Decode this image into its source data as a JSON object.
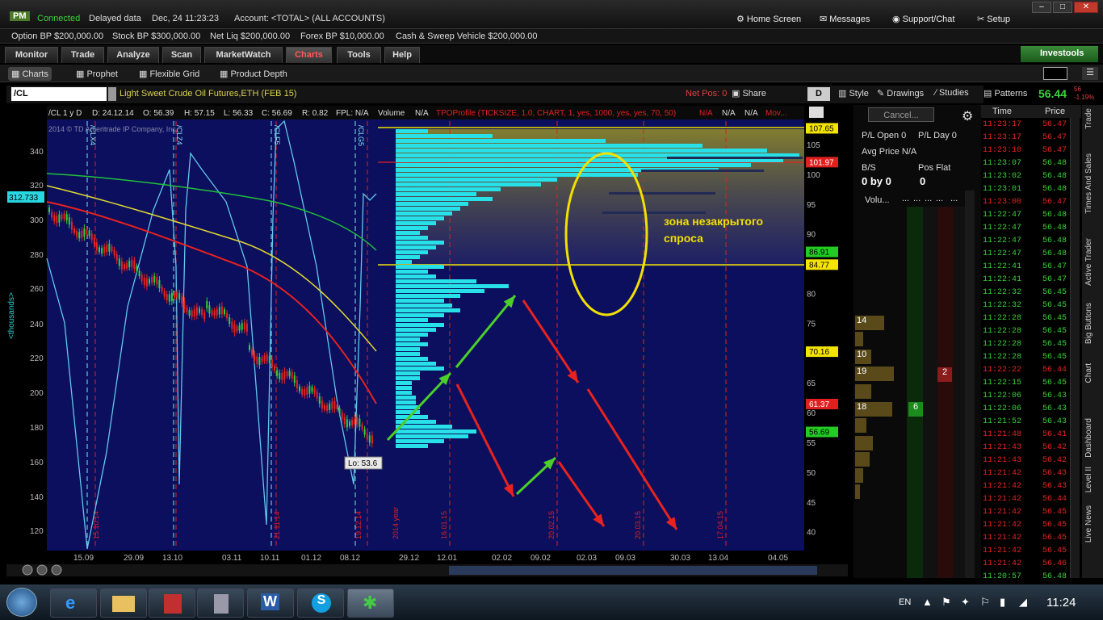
{
  "top": {
    "badge": "PM",
    "connected": "Connected",
    "delayed": "Delayed data",
    "datetime": "Dec, 24  11:23:23",
    "account": "Account: <TOTAL> (ALL ACCOUNTS)",
    "home": "Home Screen",
    "messages": "Messages",
    "support": "Support/Chat",
    "setup": "Setup"
  },
  "acct": [
    {
      "label": "Option BP",
      "value": "$200,000.00"
    },
    {
      "label": "Stock BP",
      "value": "$300,000.00"
    },
    {
      "label": "Net Liq",
      "value": "$200,000.00"
    },
    {
      "label": "Forex BP",
      "value": "$10,000.00"
    },
    {
      "label": "Cash & Sweep Vehicle",
      "value": "$200,000.00"
    }
  ],
  "tabs": [
    "Monitor",
    "Trade",
    "Analyze",
    "Scan",
    "MarketWatch",
    "Charts",
    "Tools",
    "Help"
  ],
  "investools": "Investools",
  "subtabs": [
    "Charts",
    "Prophet",
    "Flexible Grid",
    "Product Depth"
  ],
  "symbol": {
    "value": "/CL",
    "desc": "Light Sweet Crude Oil Futures,ETH (FEB 15)",
    "netpos": "Net Pos: 0",
    "share": "Share",
    "d": "D",
    "style": "Style",
    "drawings": "Drawings",
    "studies": "Studies",
    "patterns": "Patterns",
    "last": "56.44",
    "change1": "56",
    "change2": "-1.19%"
  },
  "chartinfo": {
    "sym": "/CL 1 y D",
    "d": "D: 24.12.14",
    "o": "O: 56.39",
    "h": "H: 57.15",
    "l": "L: 56.33",
    "c": "C: 56.69",
    "r": "R: 0.82",
    "fpl": "FPL: N/A",
    "vol": "Volume",
    "na1": "N/A",
    "tpo": "TPOProfile (TICKSIZE, 1.0, CHART, 1, yes, 1000, yes, yes, 70, 50)",
    "na2": "N/A",
    "na3": "N/A",
    "na4": "N/A",
    "mov": "Mov...",
    "copyright": "2014 © TD Ameritrade IP Company, Inc."
  },
  "annotation": "зона незакрытого спроса",
  "lowlabel": "Lo: 53.6",
  "leftY": [
    "340",
    "320",
    "300",
    "280",
    "260",
    "240",
    "220",
    "200",
    "180",
    "160",
    "140",
    "120"
  ],
  "leftYTitle": "<thousands>",
  "leftBadge": "312.733",
  "rightY": [
    "105",
    "100",
    "95",
    "90",
    "85",
    "80",
    "75",
    "70",
    "65",
    "60",
    "55",
    "50",
    "45",
    "40"
  ],
  "priceBadges": [
    {
      "v": "107.65",
      "c": "#f5e400"
    },
    {
      "v": "101.97",
      "c": "#e02020"
    },
    {
      "v": "86.91",
      "c": "#22cc22"
    },
    {
      "v": "84.77",
      "c": "#f5e400"
    },
    {
      "v": "70.16",
      "c": "#f5e400"
    },
    {
      "v": "61.37",
      "c": "#e02020"
    },
    {
      "v": "56.69",
      "c": "#22cc22"
    }
  ],
  "xlabels": [
    "15.09",
    "29.09",
    "13.10",
    "03.11",
    "10.11",
    "01.12",
    "08.12",
    "29.12",
    "12.01",
    "02.02",
    "09.02",
    "02.03",
    "09.03",
    "30.03",
    "13.04",
    "04.05"
  ],
  "contractLabels": [
    "/CLX4",
    "/CLZ4",
    "/CLF5",
    "/CLG5"
  ],
  "expiryLabels": [
    "15.10.14",
    "21.11.14",
    "19.12.14",
    "2014 year",
    "16.01.15",
    "20.02.15",
    "20.03.15",
    "17.04.15"
  ],
  "order": {
    "cancel": "Cancel...",
    "plopen": "P/L Open",
    "plopenv": "0",
    "plday": "P/L Day",
    "pldayv": "0",
    "avg": "Avg Price N/A",
    "bs": "B/S",
    "bsv": "0 by 0",
    "posflat": "Pos Flat",
    "posflatv": "0",
    "vol": "Volu...",
    "dots": "...",
    "ladder": [
      "14",
      "10",
      "19",
      "18"
    ],
    "ladderA": "6",
    "ladderB": "2"
  },
  "ts": {
    "head_time": "Time",
    "head_price": "Price",
    "rows": [
      [
        "11:23:17",
        "56.47",
        "r"
      ],
      [
        "11:23:17",
        "56.47",
        "r"
      ],
      [
        "11:23:10",
        "56.47",
        "r"
      ],
      [
        "11:23:07",
        "56.48",
        "g"
      ],
      [
        "11:23:02",
        "56.48",
        "g"
      ],
      [
        "11:23:01",
        "56.48",
        "g"
      ],
      [
        "11:23:00",
        "56.47",
        "r"
      ],
      [
        "11:22:47",
        "56.48",
        "g"
      ],
      [
        "11:22:47",
        "56.48",
        "g"
      ],
      [
        "11:22:47",
        "56.48",
        "g"
      ],
      [
        "11:22:47",
        "56.48",
        "g"
      ],
      [
        "11:22:41",
        "56.47",
        "g"
      ],
      [
        "11:22:41",
        "56.47",
        "g"
      ],
      [
        "11:22:32",
        "56.45",
        "g"
      ],
      [
        "11:22:32",
        "56.45",
        "g"
      ],
      [
        "11:22:28",
        "56.45",
        "g"
      ],
      [
        "11:22:28",
        "56.45",
        "g"
      ],
      [
        "11:22:28",
        "56.45",
        "g"
      ],
      [
        "11:22:28",
        "56.45",
        "g"
      ],
      [
        "11:22:22",
        "56.44",
        "r"
      ],
      [
        "11:22:15",
        "56.45",
        "g"
      ],
      [
        "11:22:06",
        "56.43",
        "g"
      ],
      [
        "11:22:06",
        "56.43",
        "g"
      ],
      [
        "11:21:52",
        "56.43",
        "g"
      ],
      [
        "11:21:48",
        "56.41",
        "r"
      ],
      [
        "11:21:43",
        "56.42",
        "r"
      ],
      [
        "11:21:43",
        "56.42",
        "r"
      ],
      [
        "11:21:42",
        "56.43",
        "r"
      ],
      [
        "11:21:42",
        "56.43",
        "r"
      ],
      [
        "11:21:42",
        "56.44",
        "r"
      ],
      [
        "11:21:42",
        "56.45",
        "r"
      ],
      [
        "11:21:42",
        "56.45",
        "r"
      ],
      [
        "11:21:42",
        "56.45",
        "r"
      ],
      [
        "11:21:42",
        "56.45",
        "r"
      ],
      [
        "11:21:42",
        "56.46",
        "r"
      ],
      [
        "11:20:57",
        "56.48",
        "g"
      ]
    ]
  },
  "sidetabs": [
    "Trade",
    "Times And Sales",
    "Active Trader",
    "Big Buttons",
    "Chart",
    "Dashboard",
    "Level II",
    "Live News"
  ],
  "tray": {
    "lang": "EN",
    "time": "11:24"
  },
  "colors": {
    "accent": "#ff5a5a",
    "profile": "#27e0e8",
    "green": "#34d134",
    "red": "#e8221f",
    "yellow": "#f2e000"
  }
}
